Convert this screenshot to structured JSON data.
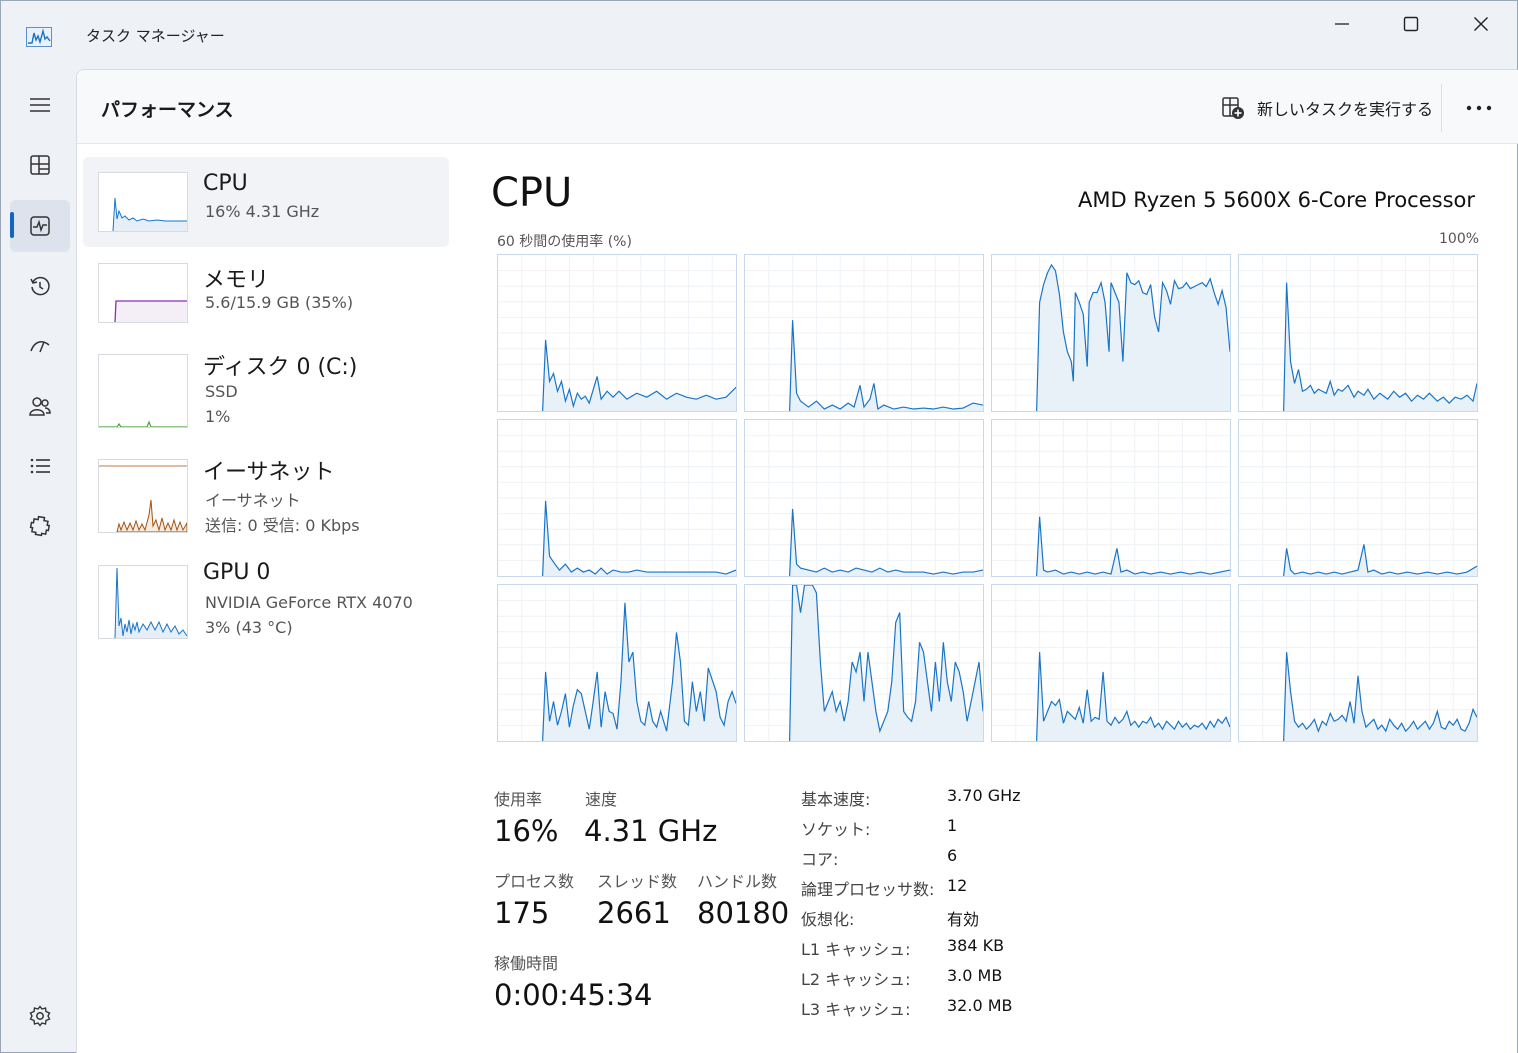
{
  "window": {
    "title": "タスク マネージャー",
    "accent_color": "#1064c8"
  },
  "nav": {
    "items": [
      {
        "icon": "hamburger-menu-icon"
      },
      {
        "icon": "processes-icon"
      },
      {
        "icon": "performance-icon",
        "active": true
      },
      {
        "icon": "app-history-icon"
      },
      {
        "icon": "startup-apps-icon"
      },
      {
        "icon": "users-icon"
      },
      {
        "icon": "details-icon"
      },
      {
        "icon": "services-icon"
      }
    ],
    "settings_icon": "settings-gear-icon"
  },
  "header": {
    "title": "パフォーマンス",
    "new_task_label": "新しいタスクを実行する",
    "more_icon": "more-options-icon"
  },
  "devices": [
    {
      "name": "CPU",
      "line1": "16%  4.31 GHz",
      "line2": "",
      "color": "#1874c8"
    },
    {
      "name": "メモリ",
      "line1": "5.6/15.9 GB (35%)",
      "line2": "",
      "color": "#8b2fb0"
    },
    {
      "name": "ディスク 0 (C:)",
      "line1": "SSD",
      "line2": "1%",
      "color": "#4ea53c"
    },
    {
      "name": "イーサネット",
      "line1": "イーサネット",
      "line2": "送信: 0  受信: 0 Kbps",
      "color": "#a4520f"
    },
    {
      "name": "GPU 0",
      "line1": "NVIDIA GeForce RTX 4070",
      "line2": "3%  (43 °C)",
      "color": "#1874c8"
    }
  ],
  "detail": {
    "title": "CPU",
    "model": "AMD Ryzen 5 5600X 6-Core Processor",
    "graph_label_left": "60 秒間の使用率 (%)",
    "graph_label_right": "100%",
    "line_color": "#1874c8",
    "fill_color": "#e8f0f8"
  },
  "stats": {
    "usage_label": "使用率",
    "usage_value": "16%",
    "speed_label": "速度",
    "speed_value": "4.31 GHz",
    "processes_label": "プロセス数",
    "processes_value": "175",
    "threads_label": "スレッド数",
    "threads_value": "2661",
    "handles_label": "ハンドル数",
    "handles_value": "80180",
    "uptime_label": "稼働時間",
    "uptime_value": "0:00:45:34"
  },
  "info": [
    {
      "label": "基本速度:",
      "value": "3.70 GHz"
    },
    {
      "label": "ソケット:",
      "value": "1"
    },
    {
      "label": "コア:",
      "value": "6"
    },
    {
      "label": "論理プロセッサ数:",
      "value": "12"
    },
    {
      "label": "仮想化:",
      "value": "有効"
    },
    {
      "label": "L1 キャッシュ:",
      "value": "384 KB"
    },
    {
      "label": "L2 キャッシュ:",
      "value": "3.0 MB"
    },
    {
      "label": "L3 キャッシュ:",
      "value": "32.0 MB"
    }
  ]
}
